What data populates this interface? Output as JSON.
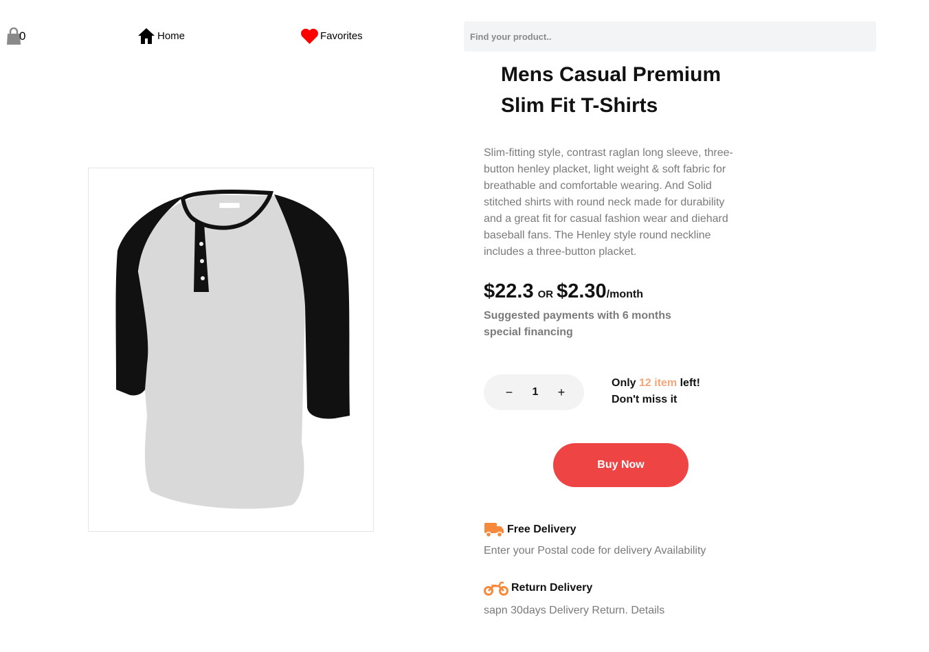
{
  "header": {
    "cart_count": "0",
    "nav": {
      "home_label": "Home",
      "favorites_label": "Favorites"
    },
    "search": {
      "placeholder": "Find your product.."
    }
  },
  "product": {
    "title_line1": "Mens Casual Premium",
    "title_line2": "Slim Fit T-Shirts",
    "description": "Slim-fitting style, contrast raglan long sleeve, three-button henley placket, light weight & soft fabric for breathable and comfortable wearing. And Solid stitched shirts with round neck made for durability and a great fit for casual fashion wear and diehard baseball fans. The Henley style round neckline includes a three-button placket.",
    "price": "$22.3",
    "or_label": "OR",
    "monthly_price": "$2.30",
    "per_month_label": "/month",
    "financing_note": "Suggested payments with 6 months special financing",
    "quantity": {
      "minus": "−",
      "value": "1",
      "plus": "+"
    },
    "stock": {
      "prefix": "Only ",
      "count": "12 item",
      "suffix": " left!",
      "line2": "Don't miss it"
    },
    "buy_label": "Buy Now"
  },
  "delivery": {
    "free_title": "Free Delivery",
    "free_sub": "Enter your Postal code for delivery Availability",
    "return_title": "Return Delivery",
    "return_sub": "sapn 30days Delivery Return. Details"
  },
  "colors": {
    "accent_red": "#ef4444",
    "accent_orange": "#f4a77a",
    "icon_orange": "#f7893b",
    "heart_red": "#ff0000",
    "muted_text": "#7a7a7a",
    "search_bg": "#f3f4f6"
  },
  "icons": {
    "cart": "shopping-bag-icon",
    "home": "home-icon",
    "favorites": "heart-icon",
    "free_delivery": "truck-icon",
    "return_delivery": "motorcycle-icon"
  }
}
